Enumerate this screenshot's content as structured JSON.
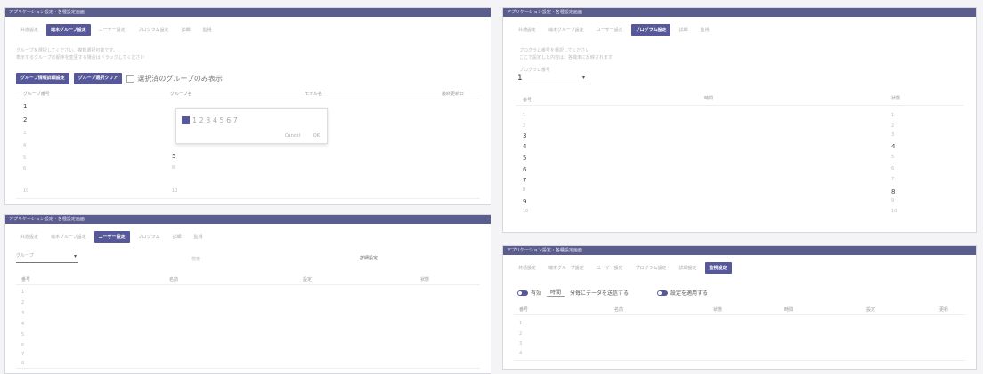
{
  "panel_a": {
    "title": "アプリケーション設定・各種設定画面",
    "tabs": [
      "共通設定",
      "端末グループ設定",
      "ユーザー設定",
      "プログラム設定",
      "詳細",
      "監視"
    ],
    "hint1": "グループを選択してください。複数選択可能です。",
    "hint2": "表示するグループの順序を変更する場合はドラッグしてください",
    "btn_setting": "グループ情報詳細設定",
    "btn_clear": "グループ選択クリア",
    "chk_label": "選択済のグループのみ表示",
    "headers": [
      "グループ番号",
      "グループ名",
      "モデル名",
      "最終更新日"
    ],
    "rows": [
      "1",
      "2",
      "3",
      "4",
      "5",
      "6",
      "10"
    ],
    "popup": {
      "check": "1 2 3 4 5 6 7",
      "cancel": "Cancel",
      "ok": "OK"
    },
    "col2_vals": [
      "5",
      "6",
      "10"
    ]
  },
  "panel_b": {
    "title": "アプリケーション設定・各種設定画面",
    "tabs": [
      "共通設定",
      "端末グループ設定",
      "ユーザー設定",
      "プログラム設定",
      "詳細",
      "監視"
    ],
    "hint1": "プログラム番号を選択してください",
    "hint2": "ここで設定した内容は、各端末に反映されます",
    "select_label": "プログラム番号",
    "select_value": "1",
    "headers": [
      "番号",
      "時間",
      "状態"
    ],
    "rows": [
      "1",
      "2",
      "3",
      "4",
      "5",
      "6",
      "7",
      "8",
      "9",
      "10"
    ],
    "col3": [
      "1",
      "2",
      "3",
      "4",
      "5",
      "6",
      "7",
      "8",
      "9",
      "10"
    ]
  },
  "panel_c": {
    "title": "アプリケーション設定・各種設定画面",
    "tabs": [
      "共通設定",
      "端末グループ設定",
      "ユーザー設定",
      "プログラム",
      "詳細",
      "監視"
    ],
    "select_label": "グループ",
    "search_label": "検索",
    "right_label": "詳細設定",
    "headers": [
      "番号",
      "名前",
      "設定",
      "状態"
    ],
    "rows": [
      "1",
      "2",
      "3",
      "4",
      "5",
      "6",
      "7",
      "8"
    ]
  },
  "panel_d": {
    "title": "アプリケーション設定・各種設定画面",
    "tabs": [
      "共通設定",
      "端末グループ設定",
      "ユーザー設定",
      "プログラム設定",
      "詳細設定",
      "監視設定"
    ],
    "toggle1": "有効",
    "toggle1_mid": "時間",
    "toggle1_tail": "分毎にデータを送信する",
    "toggle2": "設定を適用する",
    "headers": [
      "番号",
      "名前",
      "状態",
      "時間",
      "設定",
      "更新"
    ],
    "rows": [
      "1",
      "2",
      "3",
      "4"
    ]
  }
}
